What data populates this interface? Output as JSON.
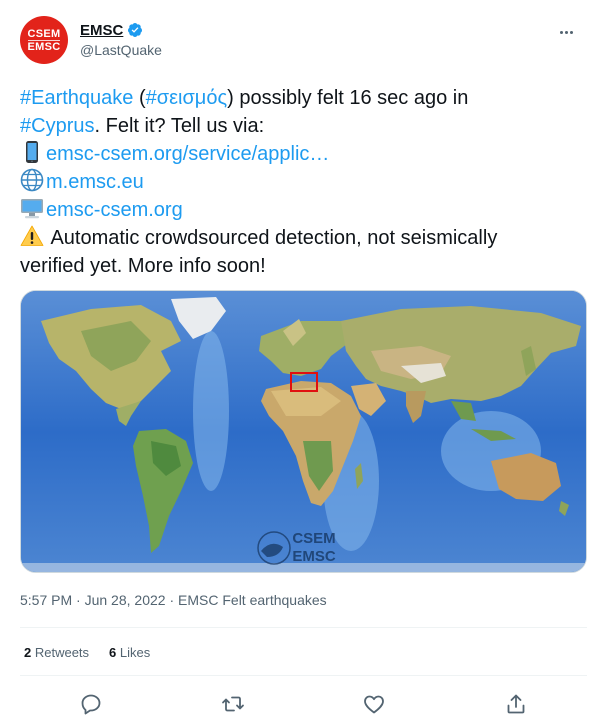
{
  "header": {
    "display_name": "EMSC",
    "handle": "@LastQuake",
    "avatar_text": [
      "CSEM",
      "EMSC"
    ],
    "verified": true
  },
  "tweet": {
    "line1_pre": "#Earthquake",
    "line1_paren_open": " (",
    "line1_tag2": "#σεισμός",
    "line1_post": ") possibly felt 16 sec ago in",
    "line2_tag": "#Cyprus",
    "line2_post": ". Felt it? Tell us via:",
    "links": [
      {
        "icon": "mobile-phone-icon",
        "text": "emsc-csem.org/service/applic…"
      },
      {
        "icon": "globe-icon",
        "text": "m.emsc.eu"
      },
      {
        "icon": "desktop-computer-icon",
        "text": "emsc-csem.org"
      }
    ],
    "warning_icon": "warning-icon",
    "warning_line1": " Automatic crowdsourced detection, not seismically",
    "warning_line2": "verified yet. More info soon!"
  },
  "media": {
    "alt": "World map with Cyprus region highlighted",
    "watermark_line1": "CSEM",
    "watermark_line2": "EMSC",
    "highlight_color": "#e01010"
  },
  "meta": {
    "time": "5:57 PM",
    "dot": " · ",
    "date": "Jun 28, 2022",
    "source": "EMSC Felt earthquakes"
  },
  "stats": {
    "retweets_count": "2",
    "retweets_label": " Retweets",
    "likes_count": "6",
    "likes_label": " Likes"
  },
  "actions": [
    "reply-icon",
    "retweet-icon",
    "like-icon",
    "share-icon"
  ],
  "colors": {
    "accent": "#1d9bf0",
    "text": "#0f1419",
    "muted": "#536471",
    "brand_red": "#e2231a"
  }
}
